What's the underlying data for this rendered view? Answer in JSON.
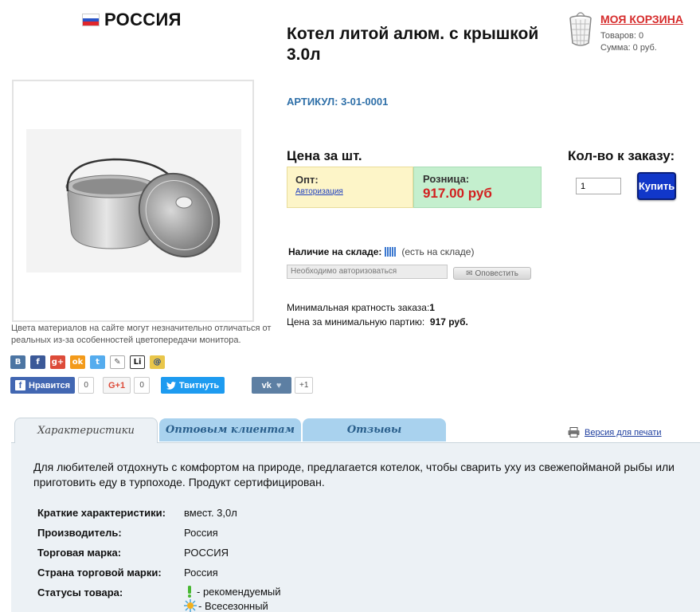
{
  "brand": {
    "name": "РОССИЯ"
  },
  "product": {
    "title": "Котел литой алюм. с крышкой 3.0л",
    "sku": "АРТИКУЛ: 3-01-0001",
    "image_alt": "Котел литой алюминиевый с крышкой",
    "color_note": "Цвета материалов на сайте могут незначительно отличаться от реальных из-за особенностей цветопередачи монитора."
  },
  "cart": {
    "title": "МОЯ КОРЗИНА",
    "items": "Товаров: 0",
    "sum": "Сумма: 0 руб."
  },
  "price": {
    "heading": "Цена за шт.",
    "opt_label": "Опт:",
    "auth_link": "Авторизация",
    "retail_label": "Розница:",
    "retail_price": "917.00 руб"
  },
  "order": {
    "heading": "Кол-во к заказу:",
    "quantity": "1",
    "buy_label": "Купить"
  },
  "stock": {
    "label": "Наличие на складе:",
    "status": "(есть на складе)",
    "notify_placeholder": "Необходимо авторизоваться",
    "notify_button": "Оповестить"
  },
  "minimum": {
    "multiplicity_label": "Минимальная кратность заказа:",
    "multiplicity_value": "1",
    "batch_price_label": "Цена за минимальную партию:",
    "batch_price_value": "917 руб."
  },
  "share": {
    "icons": [
      "В",
      "f",
      "g+",
      "ok",
      "t",
      "✎",
      "Li",
      "@"
    ],
    "fb_label": "Нравится",
    "fb_count": "0",
    "gplus_label": "G+1",
    "gplus_count": "0",
    "tw_label": "Твитнуть",
    "vk_count": "+1"
  },
  "tabs": {
    "items": [
      "Характеристики",
      "Оптовым клиентам",
      "Отзывы"
    ],
    "print_label": "Версия для печати"
  },
  "details": {
    "description": "Для любителей отдохнуть с комфортом на природе, предлагается котелок, чтобы сварить уху из свежепойманой рыбы или приготовить еду в турпоходе. Продукт сертифицирован.",
    "specs": [
      {
        "label": "Краткие характеристики:",
        "value": "вмест. 3,0л"
      },
      {
        "label": "Производитель:",
        "value": "Россия"
      },
      {
        "label": "Торговая марка:",
        "value": "РОССИЯ"
      },
      {
        "label": "Страна торговой марки:",
        "value": "Россия"
      }
    ],
    "status_label": "Статусы товара:",
    "statuses": [
      "- рекомендуемый",
      "- Всесезонный"
    ]
  },
  "colors": {
    "accent_red": "#d62c2c",
    "link_blue": "#1f3fbf",
    "buy_blue": "#1137c9",
    "opt_bg": "#fdf5c8",
    "retail_bg": "#c4efce",
    "tab_blue": "#a9d2ee"
  }
}
